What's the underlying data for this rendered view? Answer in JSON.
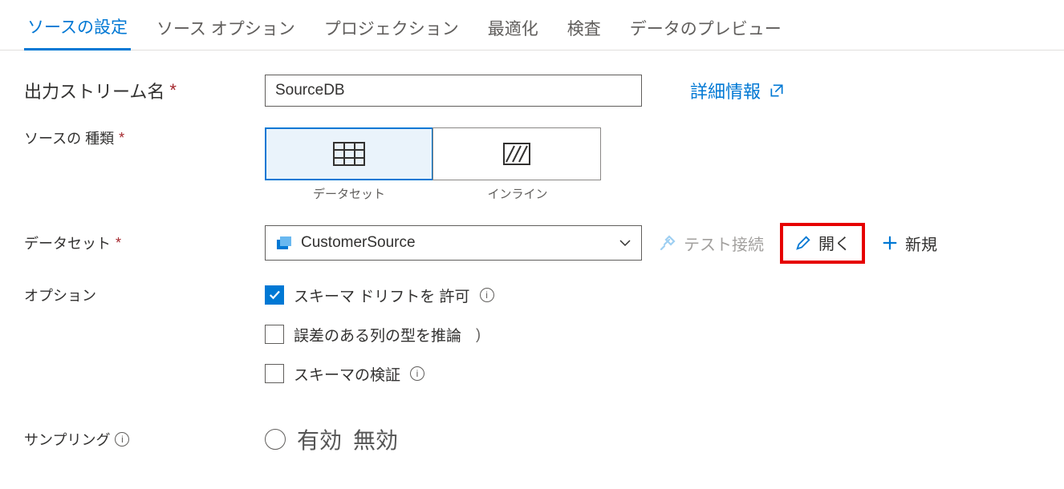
{
  "tabs": {
    "t0": "ソースの設定",
    "t1": "ソース オプション",
    "t2": "プロジェクション",
    "t3": "最適化",
    "t4": "検査",
    "t5": "データのプレビュー"
  },
  "labels": {
    "outputStream": "出力ストリーム名",
    "sourceType": "ソースの 種類",
    "dataset": "データセット",
    "options": "オプション",
    "sampling": "サンプリング"
  },
  "fields": {
    "outputStreamValue": "SourceDB",
    "moreInfo": "詳細情報",
    "typeDataset": "データセット",
    "typeInline": "インライン",
    "datasetValue": "CustomerSource",
    "testConnection": "テスト接続",
    "open": "開く",
    "new": "新規",
    "allowSchemaDrift": "スキーマ ドリフトを 許可",
    "inferDriftedTypes": "誤差のある列の型を推論",
    "validateSchema": "スキーマの検証",
    "samplingEnable": "有効",
    "samplingDisable": "無効"
  }
}
